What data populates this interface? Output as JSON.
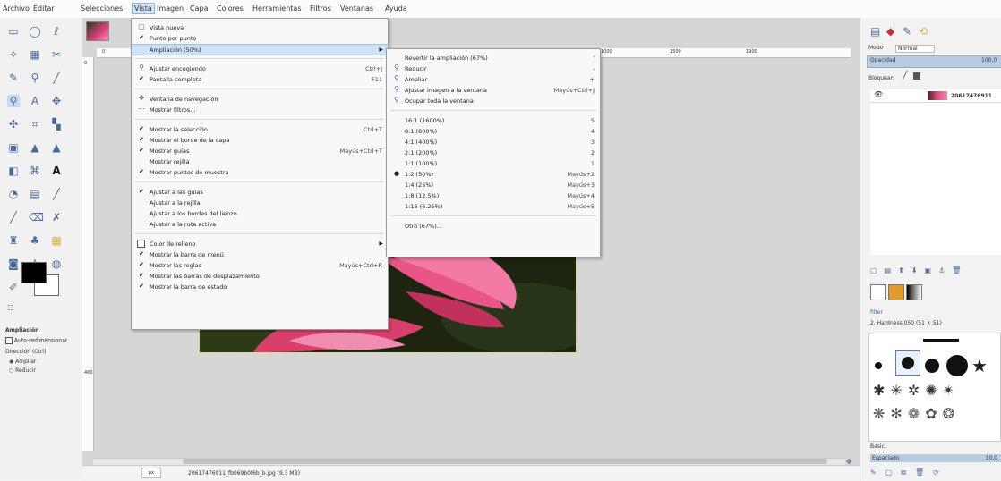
{
  "menubar": {
    "items": [
      "Archivo",
      "Editar",
      "Selecciones",
      "Vista",
      "Imagen",
      "Capa",
      "Colores",
      "Herramientas",
      "Filtros",
      "Ventanas",
      "Ayuda"
    ],
    "active_index": 3
  },
  "view_menu": {
    "items": [
      {
        "label": "Vista nueva",
        "icon": "new-view-icon"
      },
      {
        "label": "Punto por punto",
        "check": true
      },
      {
        "label": "Ampliación (50%)",
        "submenu": true,
        "highlighted": true
      },
      {
        "label": "Ajustar encogiendo",
        "icon": "shrink-wrap-icon",
        "shortcut": "Ctrl+J"
      },
      {
        "label": "Pantalla completa",
        "check": true,
        "shortcut": "F11"
      },
      {
        "label": "Ventana de navegación",
        "icon": "navigate-icon"
      },
      {
        "label": "Mostrar filtros...",
        "icon": "filters-icon"
      },
      {
        "label": "Mostrar la selección",
        "check": true,
        "shortcut": "Ctrl+T"
      },
      {
        "label": "Mostrar el borde de la capa",
        "check": true
      },
      {
        "label": "Mostrar guías",
        "check": true,
        "shortcut": "Mayús+Ctrl+T"
      },
      {
        "label": "Mostrar rejilla",
        "check": false
      },
      {
        "label": "Mostrar puntos de muestra",
        "check": true
      },
      {
        "label": "Ajustar a las guías",
        "check": true
      },
      {
        "label": "Ajustar a la rejilla",
        "check": false
      },
      {
        "label": "Ajustar a los bordes del lienzo",
        "check": false
      },
      {
        "label": "Ajustar a la ruta activa",
        "check": false
      },
      {
        "label": "Color de relleno",
        "checkbox": true,
        "submenu": true
      },
      {
        "label": "Mostrar la barra de menú",
        "check": true
      },
      {
        "label": "Mostrar las reglas",
        "check": true,
        "shortcut": "Mayús+Ctrl+R"
      },
      {
        "label": "Mostrar las barras de desplazamiento",
        "check": true
      },
      {
        "label": "Mostrar la barra de estado",
        "check": true
      }
    ]
  },
  "zoom_menu": {
    "items": [
      {
        "label": "Revertir la ampliación (67%)",
        "shortcut": "'"
      },
      {
        "label": "Reducir",
        "icon": "zoom-out-icon",
        "shortcut": "-"
      },
      {
        "label": "Ampliar",
        "icon": "zoom-in-icon",
        "shortcut": "+"
      },
      {
        "label": "Ajustar imagen a la ventana",
        "icon": "zoom-fit-icon",
        "shortcut": "Mayús+Ctrl+J"
      },
      {
        "label": "Ocupar toda la ventana",
        "icon": "zoom-fill-icon"
      },
      {
        "label": "16:1 (1600%)",
        "shortcut": "5"
      },
      {
        "label": "8:1 (800%)",
        "shortcut": "4"
      },
      {
        "label": "4:1 (400%)",
        "shortcut": "3"
      },
      {
        "label": "2:1 (200%)",
        "shortcut": "2"
      },
      {
        "label": "1:1 (100%)",
        "shortcut": "1"
      },
      {
        "label": "1:2 (50%)",
        "shortcut": "Mayús+2",
        "selected": true
      },
      {
        "label": "1:4 (25%)",
        "shortcut": "Mayús+3"
      },
      {
        "label": "1:8 (12.5%)",
        "shortcut": "Mayús+4"
      },
      {
        "label": "1:16 (6.25%)",
        "shortcut": "Mayús+5"
      },
      {
        "label": "Otro (67%)..."
      }
    ]
  },
  "rulers": {
    "h_ticks": [
      "0",
      "1000",
      "1500",
      "1900"
    ],
    "v_ticks": [
      "0",
      "400"
    ]
  },
  "status": {
    "unit": "px",
    "text": "20617476911_fb069b0f6b_b.jpg (9,3 MB)"
  },
  "tool_options": {
    "title": "Ampliación",
    "auto_resize": "Auto-redimensionar",
    "direction_label": "Dirección (Ctrl)",
    "zoom_in": "Ampliar",
    "zoom_out": "Reducir"
  },
  "dock": {
    "mode_label": "Modo",
    "mode_value": "Normal",
    "opacity_label": "Opacidad",
    "opacity_value": "100,0",
    "lock_label": "Bloquear:",
    "layer_name": "20617476911",
    "brush_label": "2. Hardness 050 (51 × 51)",
    "basic_label": "Basic,",
    "spacing_label": "Espaciado",
    "spacing_value": "10,0"
  },
  "colors": {
    "menu_highlight": "#cfe2f7",
    "foreground": "#000000",
    "background": "#ffffff",
    "accent": "#4a6b9a"
  }
}
